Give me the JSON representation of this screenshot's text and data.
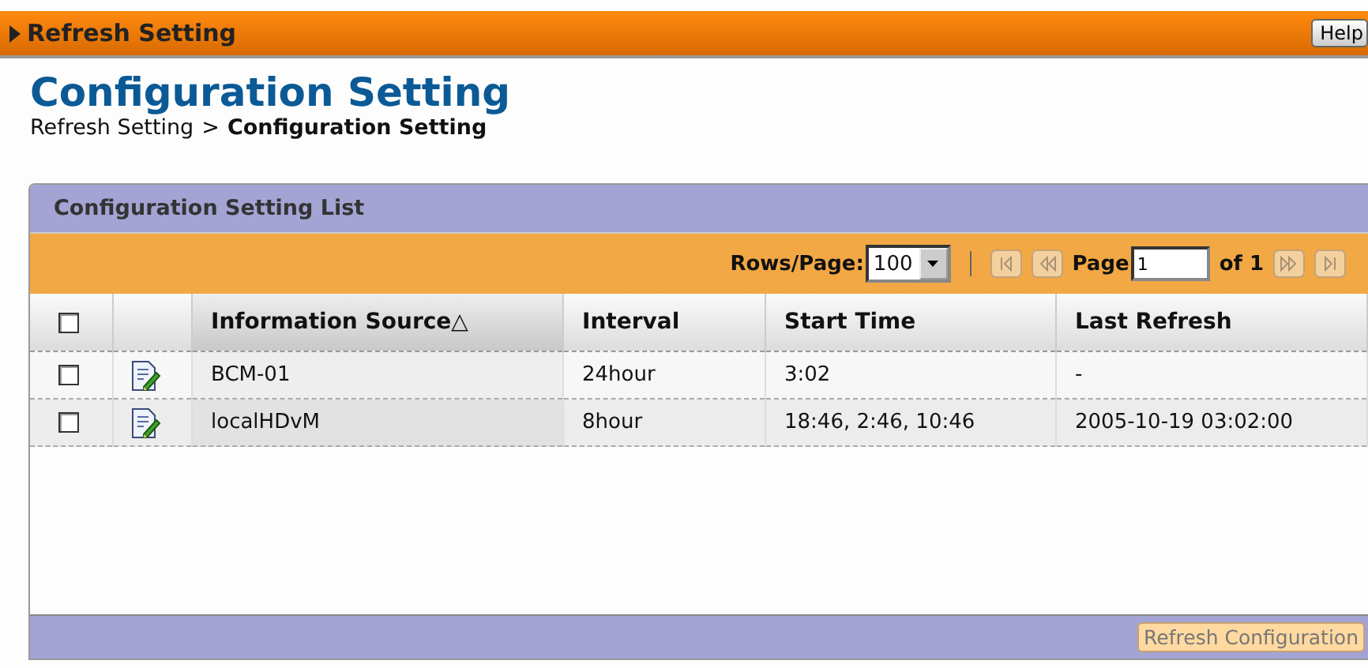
{
  "top_bar": {
    "title": "Refresh Setting",
    "help_button": "Help"
  },
  "page": {
    "title": "Configuration Setting",
    "breadcrumb": [
      {
        "label": "Refresh Setting",
        "current": false
      },
      {
        "label": "Configuration Setting",
        "current": true
      }
    ],
    "breadcrumb_separator": ">"
  },
  "panel": {
    "title": "Configuration Setting List",
    "pager": {
      "rows_label": "Rows/Page:",
      "rows_value": "100",
      "page_label": "Page",
      "page_value": "1",
      "of_label": "of 1",
      "buttons": [
        {
          "kind": "first",
          "disabled": true
        },
        {
          "kind": "prev",
          "disabled": true
        },
        {
          "kind": "next",
          "disabled": true
        },
        {
          "kind": "last",
          "disabled": true
        }
      ]
    },
    "table": {
      "select_all": {
        "checked": false
      },
      "columns": [
        {
          "label": "Information Source",
          "sort": "△",
          "sorted": true
        },
        {
          "label": "Interval",
          "sorted": false
        },
        {
          "label": "Start Time",
          "sorted": false
        },
        {
          "label": "Last Refresh",
          "sorted": false
        }
      ],
      "rows": [
        {
          "checked": false,
          "cells": [
            "BCM-01",
            "24hour",
            "3:02",
            "-"
          ]
        },
        {
          "checked": false,
          "cells": [
            "localHDvM",
            "8hour",
            "18:46, 2:46, 10:46",
            "2005-10-19 03:02:00"
          ]
        }
      ]
    },
    "footer_button": {
      "label": "Refresh Configuration",
      "disabled": true
    }
  }
}
